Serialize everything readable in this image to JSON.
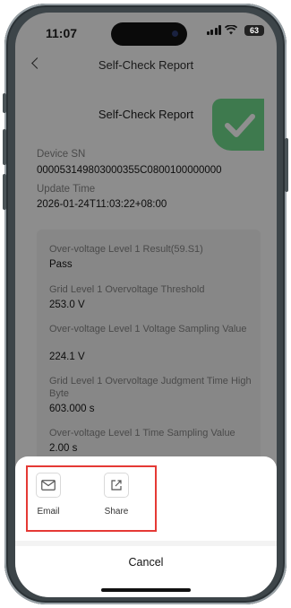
{
  "status_bar": {
    "time": "11:07",
    "battery": "63"
  },
  "nav": {
    "title": "Self-Check Report"
  },
  "report": {
    "title": "Self-Check Report",
    "device_sn_label": "Device SN",
    "device_sn_value": "000053149803000355C0800100000000",
    "update_time_label": "Update Time",
    "update_time_value": "2026-01-24T11:03:22+08:00",
    "items": [
      {
        "label": "Over-voltage Level 1 Result(59.S1)",
        "value": "Pass"
      },
      {
        "label": "Grid Level 1 Overvoltage Threshold",
        "value": "253.0 V"
      },
      {
        "label": "Over-voltage Level 1 Voltage Sampling Value",
        "value": "224.1 V"
      },
      {
        "label": "Grid Level 1 Overvoltage Judgment Time High Byte",
        "value": "603.000 s"
      },
      {
        "label": "Over-voltage Level 1 Time Sampling Value",
        "value": "2.00 s"
      }
    ]
  },
  "share_sheet": {
    "actions": [
      {
        "label": "Email",
        "icon": "mail-icon"
      },
      {
        "label": "Share",
        "icon": "share-icon"
      }
    ],
    "cancel_label": "Cancel"
  },
  "colors": {
    "highlight": "#e53935",
    "check_badge": "#3e7a4e"
  }
}
